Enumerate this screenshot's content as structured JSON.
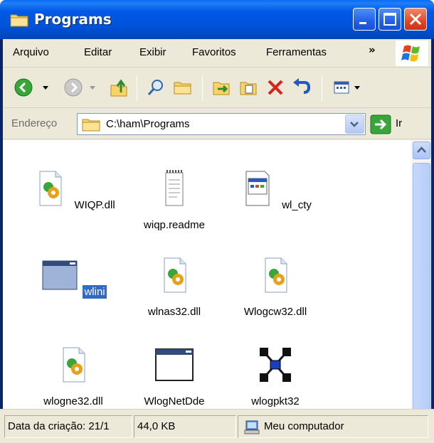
{
  "window": {
    "title": "Programs"
  },
  "menu": {
    "items": [
      "Arquivo",
      "Editar",
      "Exibir",
      "Favoritos",
      "Ferramentas"
    ],
    "overflow": "»"
  },
  "address": {
    "label": "Endereço",
    "value": "C:\\ham\\Programs",
    "go_label": "Ir"
  },
  "files": [
    {
      "name": "WIQP.dll",
      "icon": "dll-icon"
    },
    {
      "name": "wiqp.readme",
      "icon": "text-file-icon"
    },
    {
      "name": "wl_cty",
      "icon": "generic-file-icon"
    },
    {
      "name": "wlini",
      "icon": "application-window-icon",
      "selected": true
    },
    {
      "name": "wlnas32.dll",
      "icon": "dll-icon"
    },
    {
      "name": "Wlogcw32.dll",
      "icon": "dll-icon"
    },
    {
      "name": "wlogne32.dll",
      "icon": "dll-icon"
    },
    {
      "name": "WlogNetDde",
      "icon": "application-window-icon"
    },
    {
      "name": "wlogpkt32",
      "icon": "network-app-icon"
    }
  ],
  "status": {
    "created": "Data da criação: 21/1",
    "size": "44,0 KB",
    "location": "Meu computador"
  }
}
